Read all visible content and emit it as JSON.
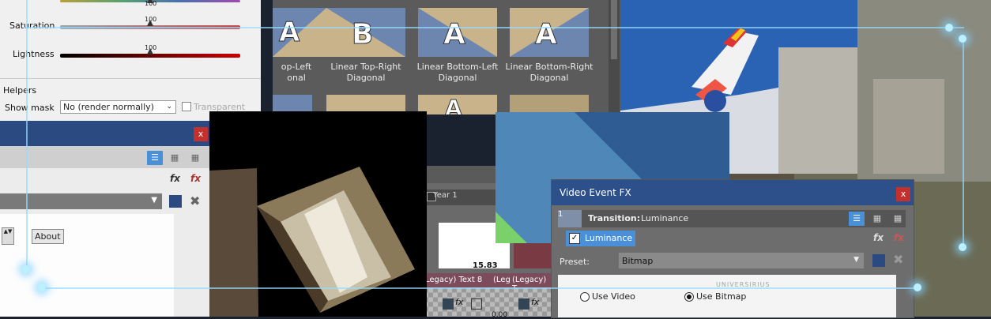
{
  "color_panel": {
    "saturation_label": "Saturation",
    "lightness_label": "Lightness",
    "saturation_value": "100",
    "lightness_value": "100",
    "top_value": "100",
    "helpers_label": "Helpers",
    "show_mask_label": "Show mask",
    "show_mask_value": "No (render normally)",
    "transparent_label": "Transparent"
  },
  "transitions": {
    "labels": [
      {
        "line1": "op-Left",
        "line2": "onal"
      },
      {
        "line1": "Linear Top-Right",
        "line2": "Diagonal"
      },
      {
        "line1": "Linear Bottom-Left",
        "line2": "Diagonal"
      },
      {
        "line1": "Linear Bottom-Right",
        "line2": "Diagonal"
      }
    ],
    "letters": [
      "A",
      "B",
      "A",
      "A",
      "",
      "",
      "A",
      ""
    ]
  },
  "fx_left": {
    "close_label": "x",
    "about_label": "About",
    "fx_add": "fx",
    "fx_remove": "fx"
  },
  "timeline": {
    "year_label": "Year 1",
    "value": "15.83",
    "clip1": "Legacy) Text 8",
    "clip2": "(Leg",
    "clip3": "(Legacy) T",
    "bottom_value": "0.00"
  },
  "vefx": {
    "title": "Video Event FX",
    "close_label": "x",
    "badge": "1",
    "transition_label": "Transition:",
    "transition_value": "Luminance",
    "plugin_label": "Luminance",
    "preset_label": "Preset:",
    "preset_value": "Bitmap",
    "use_video": "Use Video",
    "use_bitmap": "Use Bitmap",
    "watermark": "UNIVERSIRIUS"
  },
  "colors": {
    "accent": "#4a90d9",
    "close_red": "#c4302b",
    "title_blue": "#2d4f8a",
    "glow": "#bdf0ff"
  }
}
